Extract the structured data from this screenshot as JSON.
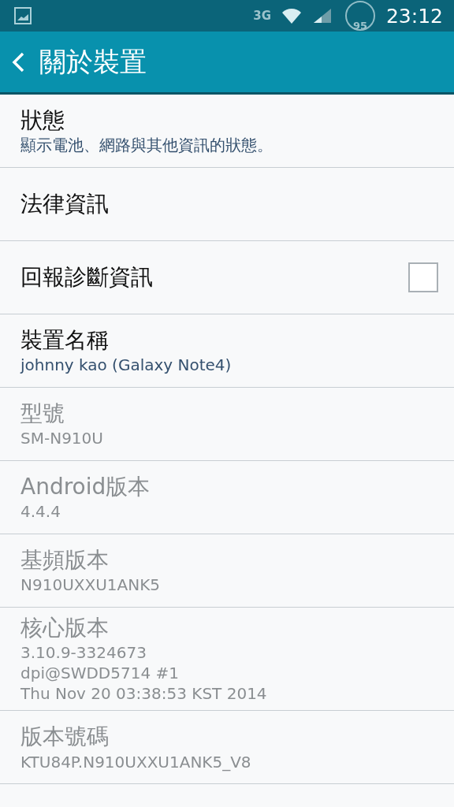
{
  "status_bar": {
    "network": "3G",
    "meter": "95",
    "time": "23:12"
  },
  "header": {
    "title": "關於裝置"
  },
  "items": [
    {
      "kind": "text",
      "title": "狀態",
      "summary": [
        "顯示電池、網路與其他資訊的狀態。"
      ],
      "disabled": false
    },
    {
      "kind": "text",
      "title": "法律資訊",
      "disabled": false
    },
    {
      "kind": "checkbox",
      "title": "回報診斷資訊",
      "checked": false,
      "disabled": false
    },
    {
      "kind": "text",
      "title": "裝置名稱",
      "summary": [
        "johnny kao (Galaxy Note4)"
      ],
      "disabled": false
    },
    {
      "kind": "text",
      "title": "型號",
      "summary": [
        "SM-N910U"
      ],
      "disabled": true
    },
    {
      "kind": "text",
      "title": "Android版本",
      "summary": [
        "4.4.4"
      ],
      "disabled": true
    },
    {
      "kind": "text",
      "title": "基頻版本",
      "summary": [
        "N910UXXU1ANK5"
      ],
      "disabled": true
    },
    {
      "kind": "text",
      "title": "核心版本",
      "summary": [
        "3.10.9-3324673",
        "dpi@SWDD5714 #1",
        "Thu Nov 20 03:38:53 KST 2014"
      ],
      "disabled": true
    },
    {
      "kind": "text",
      "title": "版本號碼",
      "summary": [
        "KTU84P.N910UXXU1ANK5_V8"
      ],
      "disabled": true
    }
  ]
}
